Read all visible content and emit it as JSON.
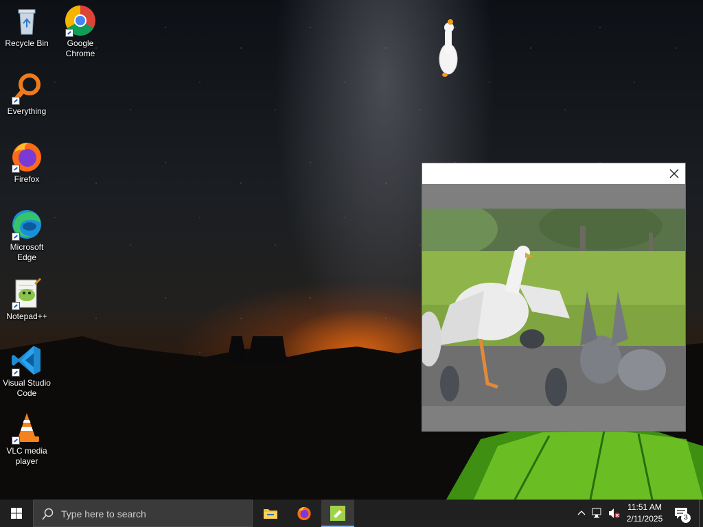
{
  "desktop": {
    "icons": [
      {
        "label": "Recycle Bin",
        "icon": "recycle-bin-icon"
      },
      {
        "label": "Google Chrome",
        "icon": "chrome-icon"
      },
      {
        "label": "Everything",
        "icon": "everything-search-icon"
      },
      {
        "label": "Firefox",
        "icon": "firefox-icon"
      },
      {
        "label": "Microsoft Edge",
        "icon": "edge-icon"
      },
      {
        "label": "Notepad++",
        "icon": "notepadpp-icon"
      },
      {
        "label": "Visual Studio Code",
        "icon": "vscode-icon"
      },
      {
        "label": "VLC media player",
        "icon": "vlc-icon"
      }
    ]
  },
  "popup": {
    "content": "goose-and-pigeons-animation"
  },
  "taskbar": {
    "search_placeholder": "Type here to search",
    "pinned": [
      {
        "name": "File Explorer",
        "icon": "folder-icon"
      },
      {
        "name": "Firefox",
        "icon": "firefox-icon"
      },
      {
        "name": "Desktop Goose",
        "icon": "goose-app-icon",
        "active": true
      }
    ],
    "tray": {
      "time": "11:51 AM",
      "date": "2/11/2025",
      "notification_count": "3"
    }
  },
  "colors": {
    "taskbar_bg": "#202020",
    "search_bg": "#3a3a3a",
    "active_underline": "#7fb3ea"
  }
}
